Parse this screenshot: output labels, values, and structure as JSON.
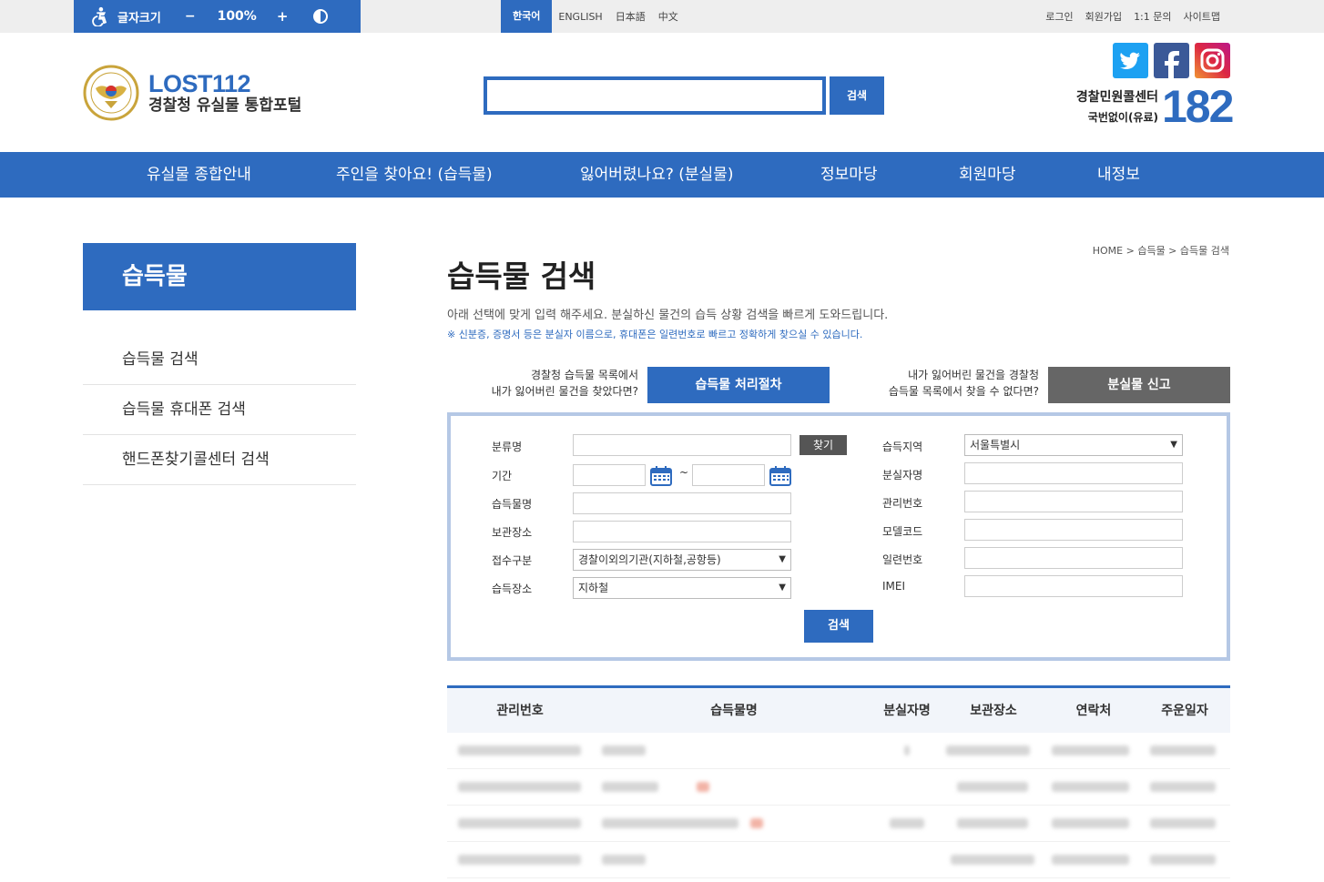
{
  "accessibility": {
    "font_size_label": "글자크기",
    "minus": "−",
    "zoom": "100%",
    "plus": "+"
  },
  "languages": [
    "한국어",
    "ENGLISH",
    "日本語",
    "中文"
  ],
  "util_links": [
    "로그인",
    "회원가입",
    "1:1 문의",
    "사이트맵"
  ],
  "logo": {
    "brand": "LOST112",
    "subtitle": "경찰청 유실물 통합포털"
  },
  "header_search": {
    "button": "검색"
  },
  "call_center": {
    "name": "경찰민원콜센터",
    "sub": "국번없이(유료)",
    "number": "182"
  },
  "gnb": [
    "유실물 종합안내",
    "주인을 찾아요! (습득물)",
    "잃어버렸나요? (분실물)",
    "정보마당",
    "회원마당",
    "내정보"
  ],
  "sidebar": {
    "title": "습득물",
    "items": [
      "습득물 검색",
      "습득물 휴대폰 검색",
      "핸드폰찾기콜센터 검색"
    ]
  },
  "breadcrumb": "HOME > 습득물 > 습득물 검색",
  "page_title": "습득물 검색",
  "description": "아래 선택에 맞게 입력 해주세요. 분실하신 물건의 습득 상황 검색을 빠르게 도와드립니다.",
  "note": "※ 신분증, 증명서 등은 분실자 이름으로, 휴대폰은 일련번호로 빠르고 정확하게 찾으실 수 있습니다.",
  "promo": {
    "left_line1": "경찰청 습득물 목록에서",
    "left_line2": "내가 잃어버린 물건을 찾았다면?",
    "left_button": "습득물 처리절차",
    "right_line1": "내가 잃어버린 물건을 경찰청",
    "right_line2": "습득물 목록에서 찾을 수 없다면?",
    "right_button": "분실물 신고"
  },
  "form": {
    "category_label": "분류명",
    "find_button": "찾기",
    "period_label": "기간",
    "tilde": "~",
    "item_name_label": "습득물명",
    "storage_label": "보관장소",
    "receipt_type_label": "접수구분",
    "receipt_type_value": "경찰이외의기관(지하철,공항등)",
    "found_place_label": "습득장소",
    "found_place_value": "지하철",
    "region_label": "습득지역",
    "region_value": "서울특별시",
    "loser_name_label": "분실자명",
    "manage_no_label": "관리번호",
    "model_code_label": "모델코드",
    "serial_no_label": "일련번호",
    "imei_label": "IMEI",
    "submit": "검색"
  },
  "table": {
    "headers": [
      "관리번호",
      "습득물명",
      "분실자명",
      "보관장소",
      "연락처",
      "주운일자"
    ]
  },
  "colors": {
    "primary": "#2e6bbf",
    "gray_button": "#666666",
    "form_border": "#b5c8e5"
  }
}
